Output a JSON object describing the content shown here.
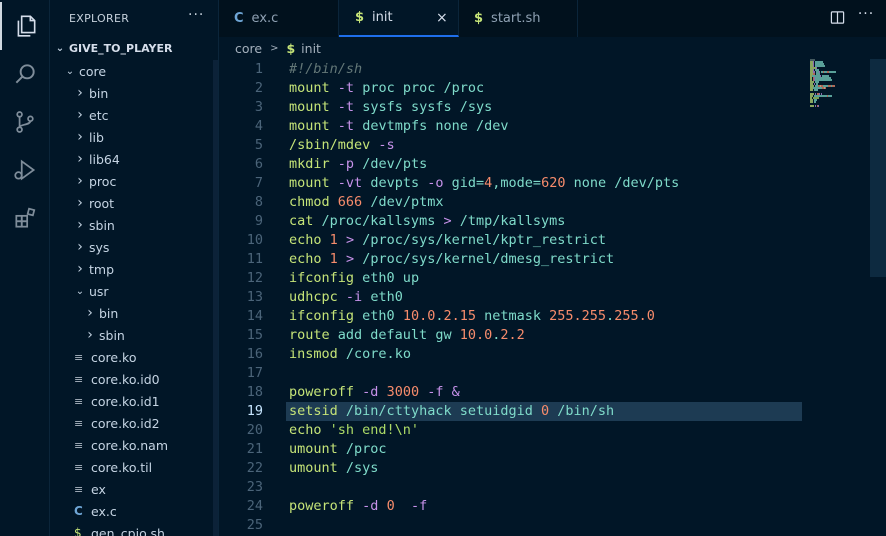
{
  "sidebar": {
    "header": "EXPLORER",
    "more": "···",
    "root": "GIVE_TO_PLAYER",
    "tree": [
      {
        "label": "core",
        "kind": "folder-open",
        "indent": 0
      },
      {
        "label": "bin",
        "kind": "folder",
        "indent": 1
      },
      {
        "label": "etc",
        "kind": "folder",
        "indent": 1
      },
      {
        "label": "lib",
        "kind": "folder",
        "indent": 1
      },
      {
        "label": "lib64",
        "kind": "folder",
        "indent": 1
      },
      {
        "label": "proc",
        "kind": "folder",
        "indent": 1
      },
      {
        "label": "root",
        "kind": "folder",
        "indent": 1
      },
      {
        "label": "sbin",
        "kind": "folder",
        "indent": 1
      },
      {
        "label": "sys",
        "kind": "folder",
        "indent": 1
      },
      {
        "label": "tmp",
        "kind": "folder",
        "indent": 1
      },
      {
        "label": "usr",
        "kind": "folder-open",
        "indent": 1
      },
      {
        "label": "bin",
        "kind": "folder",
        "indent": 2
      },
      {
        "label": "sbin",
        "kind": "folder",
        "indent": 2
      },
      {
        "label": "core.ko",
        "kind": "file",
        "indent": 1
      },
      {
        "label": "core.ko.id0",
        "kind": "file",
        "indent": 1
      },
      {
        "label": "core.ko.id1",
        "kind": "file",
        "indent": 1
      },
      {
        "label": "core.ko.id2",
        "kind": "file",
        "indent": 1
      },
      {
        "label": "core.ko.nam",
        "kind": "file",
        "indent": 1
      },
      {
        "label": "core.ko.til",
        "kind": "file",
        "indent": 1
      },
      {
        "label": "ex",
        "kind": "file",
        "indent": 1
      },
      {
        "label": "ex.c",
        "kind": "cfile",
        "indent": 1
      },
      {
        "label": "gen_cpio.sh",
        "kind": "shfile",
        "indent": 1
      }
    ]
  },
  "tabs": [
    {
      "label": "ex.c",
      "icon": "C",
      "active": false
    },
    {
      "label": "init",
      "icon": "$",
      "active": true
    },
    {
      "label": "start.sh",
      "icon": "$",
      "active": false
    }
  ],
  "tab_close": "×",
  "tab_actions": {
    "split": "split-editor-icon",
    "more": "···"
  },
  "breadcrumb": {
    "folder": "core",
    "sep": ">",
    "file_icon": "$",
    "file": "init"
  },
  "editor": {
    "current_line": 19,
    "lines": [
      [
        [
          "com",
          "#!/bin/sh"
        ]
      ],
      [
        [
          "cmd",
          "mount"
        ],
        [
          "plain",
          " "
        ],
        [
          "flag",
          "-t"
        ],
        [
          "plain",
          " "
        ],
        [
          "arg",
          "proc proc /proc"
        ]
      ],
      [
        [
          "cmd",
          "mount"
        ],
        [
          "plain",
          " "
        ],
        [
          "flag",
          "-t"
        ],
        [
          "plain",
          " "
        ],
        [
          "arg",
          "sysfs sysfs /sys"
        ]
      ],
      [
        [
          "cmd",
          "mount"
        ],
        [
          "plain",
          " "
        ],
        [
          "flag",
          "-t"
        ],
        [
          "plain",
          " "
        ],
        [
          "arg",
          "devtmpfs none /dev"
        ]
      ],
      [
        [
          "cmd",
          "/sbin/mdev"
        ],
        [
          "plain",
          " "
        ],
        [
          "flag",
          "-s"
        ]
      ],
      [
        [
          "cmd",
          "mkdir"
        ],
        [
          "plain",
          " "
        ],
        [
          "flag",
          "-p"
        ],
        [
          "plain",
          " "
        ],
        [
          "arg",
          "/dev/pts"
        ]
      ],
      [
        [
          "cmd",
          "mount"
        ],
        [
          "plain",
          " "
        ],
        [
          "flag",
          "-vt"
        ],
        [
          "plain",
          " "
        ],
        [
          "arg",
          "devpts"
        ],
        [
          "plain",
          " "
        ],
        [
          "flag",
          "-o"
        ],
        [
          "plain",
          " "
        ],
        [
          "arg",
          "gid="
        ],
        [
          "num",
          "4"
        ],
        [
          "arg",
          ",mode="
        ],
        [
          "num",
          "620"
        ],
        [
          "arg",
          " none /dev/pts"
        ]
      ],
      [
        [
          "cmd",
          "chmod"
        ],
        [
          "plain",
          " "
        ],
        [
          "num",
          "666"
        ],
        [
          "plain",
          " "
        ],
        [
          "arg",
          "/dev/ptmx"
        ]
      ],
      [
        [
          "cmd",
          "cat"
        ],
        [
          "plain",
          " "
        ],
        [
          "arg",
          "/proc/kallsyms"
        ],
        [
          "plain",
          " "
        ],
        [
          "op",
          ">"
        ],
        [
          "plain",
          " "
        ],
        [
          "arg",
          "/tmp/kallsyms"
        ]
      ],
      [
        [
          "cmd",
          "echo"
        ],
        [
          "plain",
          " "
        ],
        [
          "num",
          "1"
        ],
        [
          "plain",
          " "
        ],
        [
          "op",
          ">"
        ],
        [
          "plain",
          " "
        ],
        [
          "arg",
          "/proc/sys/kernel/kptr_restrict"
        ]
      ],
      [
        [
          "cmd",
          "echo"
        ],
        [
          "plain",
          " "
        ],
        [
          "num",
          "1"
        ],
        [
          "plain",
          " "
        ],
        [
          "op",
          ">"
        ],
        [
          "plain",
          " "
        ],
        [
          "arg",
          "/proc/sys/kernel/dmesg_restrict"
        ]
      ],
      [
        [
          "cmd",
          "ifconfig"
        ],
        [
          "plain",
          " "
        ],
        [
          "arg",
          "eth0 up"
        ]
      ],
      [
        [
          "cmd",
          "udhcpc"
        ],
        [
          "plain",
          " "
        ],
        [
          "flag",
          "-i"
        ],
        [
          "plain",
          " "
        ],
        [
          "arg",
          "eth0"
        ]
      ],
      [
        [
          "cmd",
          "ifconfig"
        ],
        [
          "plain",
          " "
        ],
        [
          "arg",
          "eth0 "
        ],
        [
          "num",
          "10.0"
        ],
        [
          "arg",
          "."
        ],
        [
          "num",
          "2.15"
        ],
        [
          "arg",
          " netmask "
        ],
        [
          "num",
          "255.255"
        ],
        [
          "arg",
          "."
        ],
        [
          "num",
          "255.0"
        ]
      ],
      [
        [
          "cmd",
          "route"
        ],
        [
          "plain",
          " "
        ],
        [
          "arg",
          "add default gw "
        ],
        [
          "num",
          "10.0"
        ],
        [
          "arg",
          "."
        ],
        [
          "num",
          "2.2"
        ]
      ],
      [
        [
          "cmd",
          "insmod"
        ],
        [
          "plain",
          " "
        ],
        [
          "arg",
          "/core.ko"
        ]
      ],
      [],
      [
        [
          "cmd",
          "poweroff"
        ],
        [
          "plain",
          " "
        ],
        [
          "flag",
          "-d"
        ],
        [
          "plain",
          " "
        ],
        [
          "num",
          "3000"
        ],
        [
          "plain",
          " "
        ],
        [
          "flag",
          "-f"
        ],
        [
          "plain",
          " "
        ],
        [
          "op",
          "&"
        ]
      ],
      [
        [
          "cmd",
          "setsid"
        ],
        [
          "plain",
          " "
        ],
        [
          "arg",
          "/bin/cttyhack setuidgid "
        ],
        [
          "num",
          "0"
        ],
        [
          "plain",
          " "
        ],
        [
          "arg",
          "/bin/sh"
        ]
      ],
      [
        [
          "cmd",
          "echo"
        ],
        [
          "plain",
          " "
        ],
        [
          "str",
          "'sh end!\\n'"
        ]
      ],
      [
        [
          "cmd",
          "umount"
        ],
        [
          "plain",
          " "
        ],
        [
          "arg",
          "/proc"
        ]
      ],
      [
        [
          "cmd",
          "umount"
        ],
        [
          "plain",
          " "
        ],
        [
          "arg",
          "/sys"
        ]
      ],
      [],
      [
        [
          "cmd",
          "poweroff"
        ],
        [
          "plain",
          " "
        ],
        [
          "flag",
          "-d"
        ],
        [
          "plain",
          " "
        ],
        [
          "num",
          "0"
        ],
        [
          "plain",
          "  "
        ],
        [
          "flag",
          "-f"
        ]
      ],
      []
    ]
  }
}
